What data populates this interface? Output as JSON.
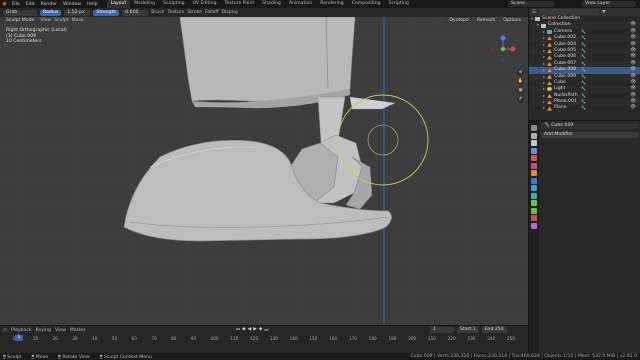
{
  "menubar": {
    "menus": [
      "File",
      "Edit",
      "Render",
      "Window",
      "Help"
    ],
    "workspaces": [
      "Layout",
      "Modeling",
      "Sculpting",
      "UV Editing",
      "Texture Paint",
      "Shading",
      "Animation",
      "Rendering",
      "Compositing",
      "Scripting"
    ],
    "active_workspace": "Layout",
    "scene": "Scene",
    "view_layer": "View Layer"
  },
  "tool_header": {
    "brush": "Grab",
    "radius_label": "Radius",
    "radius_value": "1.52 px",
    "strength_label": "Strength",
    "strength_value": "0.600",
    "menus": [
      "Brush",
      "Texture",
      "Stroke",
      "Falloff",
      "Display"
    ]
  },
  "viewport": {
    "mode": "Sculpt Mode",
    "menus": [
      "View",
      "Sculpt",
      "Mask"
    ],
    "info": [
      "Right Orthographic (Local)",
      "(1) Cube.009",
      "10 Centimeters"
    ],
    "right_header": [
      "Dyntopo",
      "Remesh",
      "Options"
    ],
    "colors": {
      "background": "#3d3d3d",
      "mesh": "#bdbdbd",
      "cursor_ring": "#c9c96a",
      "axis_line": "#3b6ac2"
    }
  },
  "outliner": {
    "title": "Scene Collection",
    "rows": [
      {
        "label": "Scene Collection",
        "type": "coll"
      },
      {
        "label": "Collection",
        "type": "coll"
      },
      {
        "label": "Camera",
        "type": "cam"
      },
      {
        "label": "Cube.002",
        "type": "mesh"
      },
      {
        "label": "Cube.004",
        "type": "mesh"
      },
      {
        "label": "Cube.005",
        "type": "mesh"
      },
      {
        "label": "Cube.006",
        "type": "mesh"
      },
      {
        "label": "Cube.007",
        "type": "mesh"
      },
      {
        "label": "Cube.008",
        "type": "mesh",
        "selected": true
      },
      {
        "label": "Cube.009",
        "type": "mesh"
      },
      {
        "label": "Cube",
        "type": "mesh"
      },
      {
        "label": "Light",
        "type": "light"
      },
      {
        "label": "NurbsPath",
        "type": "mesh"
      },
      {
        "label": "Plane.001",
        "type": "mesh"
      },
      {
        "label": "Plane",
        "type": "mesh"
      }
    ]
  },
  "properties": {
    "object_name": "Cube.009",
    "add_modifier": "Add Modifier"
  },
  "timeline": {
    "menus": [
      "Playback",
      "Keying",
      "View",
      "Marker"
    ],
    "current_frame": "1",
    "start_label": "Start",
    "start_value": "1",
    "end_label": "End",
    "end_value": "250",
    "ticks": [
      "0",
      "10",
      "20",
      "30",
      "40",
      "50",
      "60",
      "70",
      "80",
      "90",
      "100",
      "110",
      "120",
      "130",
      "140",
      "150",
      "160",
      "170",
      "180",
      "190",
      "200",
      "210",
      "220",
      "230",
      "240",
      "250"
    ]
  },
  "statusbar": {
    "items": [
      "Sculpt",
      "Move",
      "Rotate View",
      "Sculpt Context Menu"
    ],
    "stats": "Cube.009 | Verts:230,328 | Faces:230,314 | Tris:460,628 | Objects:1/15 | Mem: 532.9 MiB | v2.91.0"
  }
}
